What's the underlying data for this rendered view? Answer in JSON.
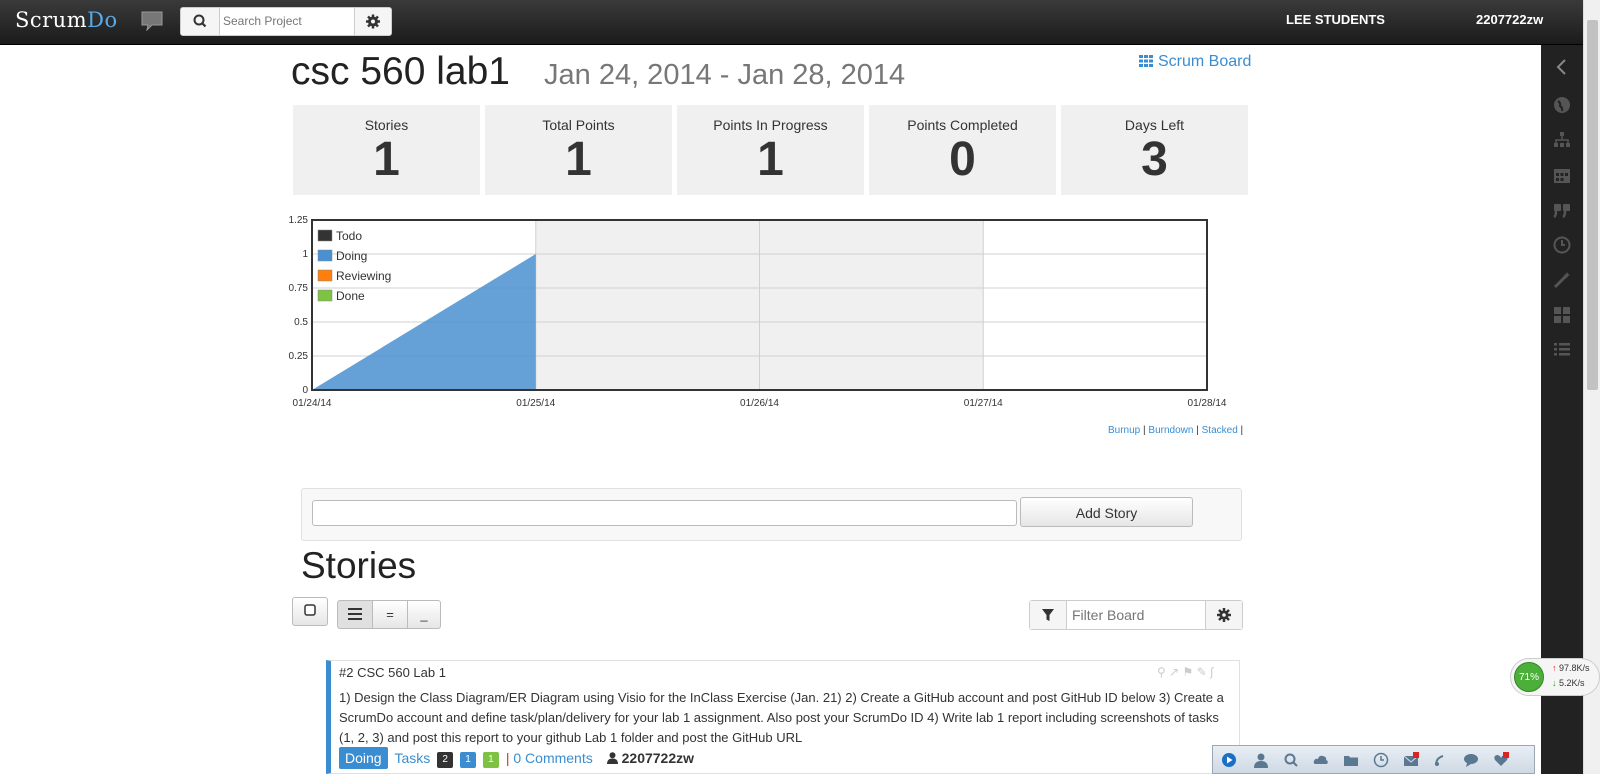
{
  "topbar": {
    "logo_main": "Scrum",
    "logo_accent": "Do",
    "search_placeholder": "Search Project",
    "org_name": "LEE STUDENTS",
    "user_name": "2207722zw"
  },
  "header": {
    "title": "csc 560 lab1",
    "date_range": "Jan 24, 2014 - Jan 28, 2014",
    "scrum_board_link": "Scrum Board"
  },
  "stats": [
    {
      "label": "Stories",
      "value": "1"
    },
    {
      "label": "Total Points",
      "value": "1"
    },
    {
      "label": "Points In Progress",
      "value": "1"
    },
    {
      "label": "Points Completed",
      "value": "0"
    },
    {
      "label": "Days Left",
      "value": "3"
    }
  ],
  "chart_data": {
    "type": "area",
    "x": [
      "01/24/14",
      "01/25/14",
      "01/26/14",
      "01/27/14",
      "01/28/14"
    ],
    "yticks": [
      "0",
      "0.25",
      "0.5",
      "0.75",
      "1",
      "1.25"
    ],
    "ylim": [
      0,
      1.25
    ],
    "series": [
      {
        "name": "Todo",
        "color": "#333333",
        "values": [
          0,
          0
        ]
      },
      {
        "name": "Doing",
        "color": "#4a90d0",
        "values": [
          0,
          1
        ]
      },
      {
        "name": "Reviewing",
        "color": "#ff7f0e",
        "values": [
          0,
          0
        ]
      },
      {
        "name": "Done",
        "color": "#7dc242",
        "values": [
          0,
          0
        ]
      }
    ],
    "legend_position": "top-left",
    "grid": true
  },
  "chart_links": {
    "burnup": "Burnup",
    "burndown": "Burndown",
    "stacked": "Stacked"
  },
  "add_story": {
    "button_label": "Add Story",
    "input_value": ""
  },
  "stories_heading": "Stories",
  "toolbar": {
    "view_buttons": [
      "=",
      "_"
    ],
    "filter_placeholder": "Filter Board"
  },
  "story": {
    "title": "#2 CSC 560 Lab 1",
    "description": "1) Design the Class Diagram/ER Diagram using Visio for the InClass Exercise (Jan. 21) 2) Create a GitHub account and post GitHub ID below 3) Create a ScrumDo account and define task/plan/delivery for your lab 1 assignment. Also post your ScrumDo ID 4) Write lab 1 report including screenshots of tasks (1, 2, 3) and post this report to your github Lab 1 folder and post the GitHub URL",
    "status": "Doing",
    "tasks_label": "Tasks",
    "task_counts": [
      {
        "value": "2",
        "color": "#333333"
      },
      {
        "value": "1",
        "color": "#3a8dd1"
      },
      {
        "value": "1",
        "color": "#7dc242"
      }
    ],
    "comments": "0 Comments",
    "owner": "2207722zw"
  },
  "net_widget": {
    "percent": "71%",
    "upload": "97.8K/s",
    "download": "5.2K/s"
  }
}
